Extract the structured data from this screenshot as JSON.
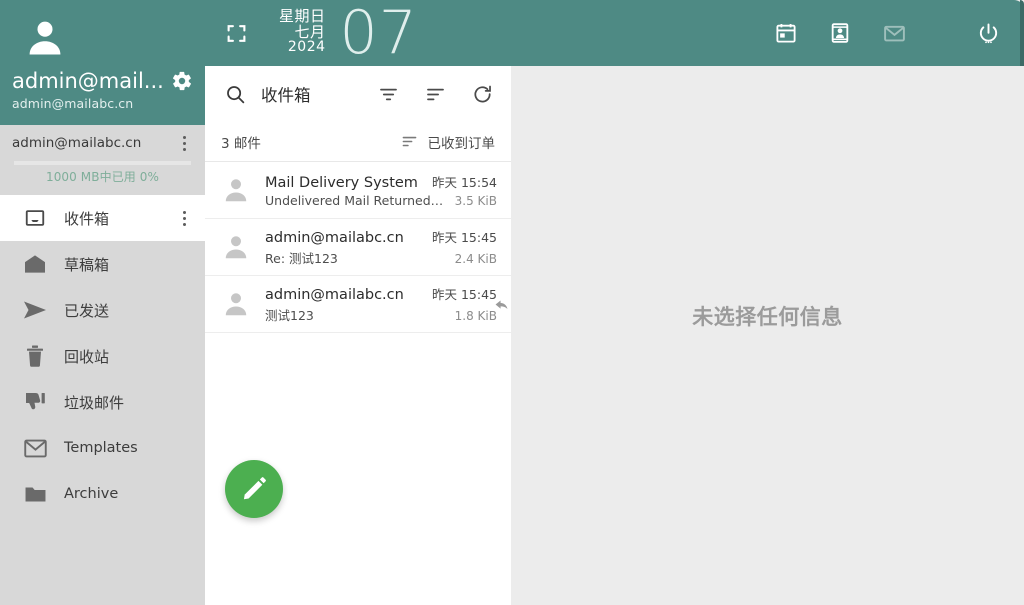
{
  "colors": {
    "teal": "#4e8a84",
    "teal_dark": "#3c6a66",
    "sidebar_bg": "#d8d8d8",
    "list_bg": "#ffffff",
    "read_bg": "#ececec",
    "fab_green": "#4caf50",
    "quota_text": "#7fae9a"
  },
  "topbar": {
    "expand_icon": "fullscreen-expand-icon",
    "date": {
      "weekday": "星期日",
      "month": "七月",
      "year": "2024",
      "day": "07"
    },
    "icons": [
      {
        "name": "calendar-icon",
        "label": "Calendar",
        "dim": false
      },
      {
        "name": "contacts-icon",
        "label": "Contacts",
        "dim": false
      },
      {
        "name": "mail-icon",
        "label": "Mail",
        "dim": true
      },
      {
        "name": "power-icon",
        "label": "Logout",
        "dim": false
      }
    ]
  },
  "sidebar": {
    "avatar_icon": "user-avatar-icon",
    "username": "admin@mail...",
    "user_email": "admin@mailabc.cn",
    "gear_icon": "gear-icon",
    "account": {
      "name": "admin@mailabc.cn",
      "menu_icon": "overflow-menu-icon",
      "quota_text": "1000 MB中已用 0%",
      "quota_percent": 0
    },
    "folders": [
      {
        "label": "收件箱",
        "icon": "inbox-icon",
        "active": true,
        "latin": false,
        "has_menu": true
      },
      {
        "label": "草稿箱",
        "icon": "drafts-icon",
        "active": false,
        "latin": false,
        "has_menu": false
      },
      {
        "label": "已发送",
        "icon": "sent-icon",
        "active": false,
        "latin": false,
        "has_menu": false
      },
      {
        "label": "回收站",
        "icon": "trash-icon",
        "active": false,
        "latin": false,
        "has_menu": false
      },
      {
        "label": "垃圾邮件",
        "icon": "spam-icon",
        "active": false,
        "latin": false,
        "has_menu": false
      },
      {
        "label": "Templates",
        "icon": "envelope-icon",
        "active": false,
        "latin": true,
        "has_menu": false
      },
      {
        "label": "Archive",
        "icon": "folder-icon",
        "active": false,
        "latin": true,
        "has_menu": false
      }
    ]
  },
  "list": {
    "toolbar": {
      "search_icon": "search-icon",
      "title": "收件箱",
      "filter_icon": "filter-icon",
      "sort_icon": "sort-icon",
      "refresh_icon": "refresh-icon"
    },
    "count_text": "3 邮件",
    "sort_label": "已收到订单",
    "sort_mini_icon": "sort-icon",
    "messages": [
      {
        "from": "Mail Delivery System",
        "subject": "Undelivered Mail Returned to …",
        "date": "昨天 15:54",
        "size": "3.5 KiB",
        "avatar_icon": "contact-avatar-icon",
        "flag_icon": ""
      },
      {
        "from": "admin@mailabc.cn",
        "subject": "Re: 测试123",
        "date": "昨天 15:45",
        "size": "2.4 KiB",
        "avatar_icon": "contact-avatar-icon",
        "flag_icon": ""
      },
      {
        "from": "admin@mailabc.cn",
        "subject": "测试123",
        "date": "昨天 15:45",
        "size": "1.8 KiB",
        "avatar_icon": "contact-avatar-icon",
        "flag_icon": "reply-arrow-icon"
      }
    ],
    "compose": {
      "icon": "pencil-compose-icon",
      "label": "Compose"
    }
  },
  "reading_pane": {
    "empty_text": "未选择任何信息"
  }
}
